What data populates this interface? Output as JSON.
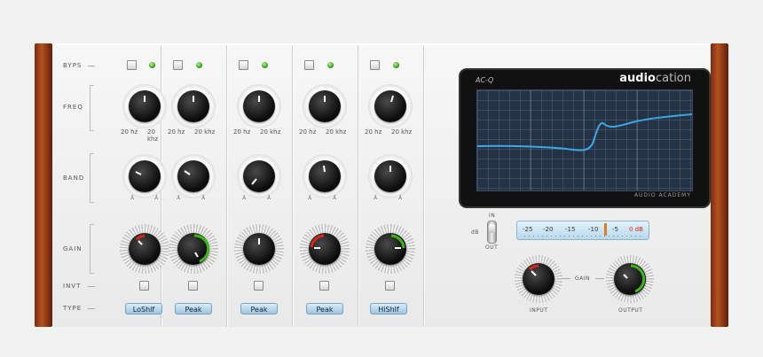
{
  "rows": {
    "bypass": "BYPS",
    "freq": "FREQ",
    "band": "BAND",
    "gain": "GAIN",
    "invert": "INVT",
    "type": "TYPE"
  },
  "bands": [
    {
      "type": "LoShlf",
      "freq_min": "20 hz",
      "freq_max": "20 khz"
    },
    {
      "type": "Peak",
      "freq_min": "20 hz",
      "freq_max": "20 khz"
    },
    {
      "type": "Peak",
      "freq_min": "20 hz",
      "freq_max": "20 khz"
    },
    {
      "type": "Peak",
      "freq_min": "20 hz",
      "freq_max": "20 khz"
    },
    {
      "type": "HiShlf",
      "freq_min": "20 hz",
      "freq_max": "20 khz"
    }
  ],
  "display": {
    "model": "AC-Q",
    "brand_bold": "audio",
    "brand_light": "cation",
    "footer": "AUDIO ACADEMY"
  },
  "switch": {
    "in": "IN",
    "db": "dB",
    "out": "OUT"
  },
  "meter": {
    "ticks": [
      "-25",
      "-20",
      "-15",
      "-10",
      "-5",
      "0 dB"
    ]
  },
  "output_section": {
    "input_label": "INPUT",
    "gain_label": "GAIN",
    "output_label": "OUTPUT"
  },
  "colors": {
    "accent_green": "#3bb818",
    "accent_red": "#d8261a",
    "curve": "#3aa9e6",
    "wood": "#9a4418"
  }
}
